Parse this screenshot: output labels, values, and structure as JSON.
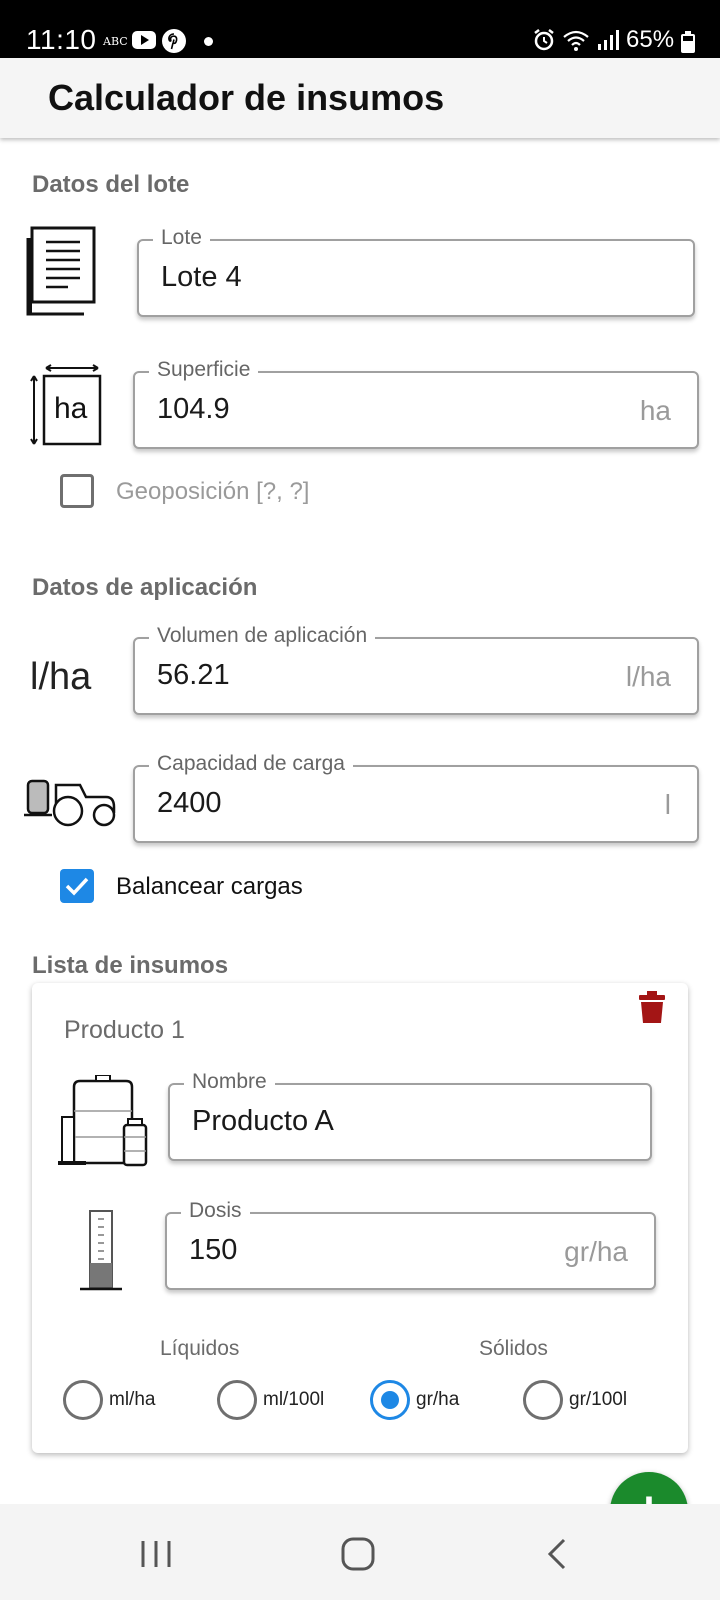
{
  "status_bar": {
    "time": "11:10",
    "abc": "ABC",
    "battery": "65%",
    "icons": [
      "youtube-icon",
      "pinterest-icon",
      "dot-icon",
      "alarm-icon",
      "wifi-icon",
      "signal-icon",
      "battery-icon"
    ]
  },
  "app_bar": {
    "title": "Calculador de insumos"
  },
  "lote_section": {
    "title": "Datos del lote",
    "lote_label": "Lote",
    "lote_value": "Lote 4",
    "superficie_label": "Superficie",
    "superficie_value": "104.9",
    "superficie_unit": "ha",
    "superficie_icon_text": "ha",
    "geo_label": "Geoposición [?, ?]",
    "geo_checked": false
  },
  "aplicacion_section": {
    "title": "Datos de aplicación",
    "volumen_icon_text": "l/ha",
    "volumen_label": "Volumen de aplicación",
    "volumen_value": "56.21",
    "volumen_unit": "l/ha",
    "capacidad_label": "Capacidad de carga",
    "capacidad_value": "2400",
    "capacidad_unit": "l",
    "balancear_label": "Balancear cargas",
    "balancear_checked": true
  },
  "insumos_section": {
    "title": "Lista de insumos",
    "products": [
      {
        "title": "Producto 1",
        "nombre_label": "Nombre",
        "nombre_value": "Producto A",
        "dosis_label": "Dosis",
        "dosis_value": "150",
        "dosis_unit": "gr/ha",
        "liquidos_label": "Líquidos",
        "solidos_label": "Sólidos",
        "units": [
          "ml/ha",
          "ml/100l",
          "gr/ha",
          "gr/100l"
        ],
        "selected_unit": "gr/ha"
      }
    ]
  },
  "fab": {
    "label": "+"
  },
  "colors": {
    "accent": "#1e88e5",
    "fab": "#1b8a2c",
    "trash": "#a31515"
  }
}
